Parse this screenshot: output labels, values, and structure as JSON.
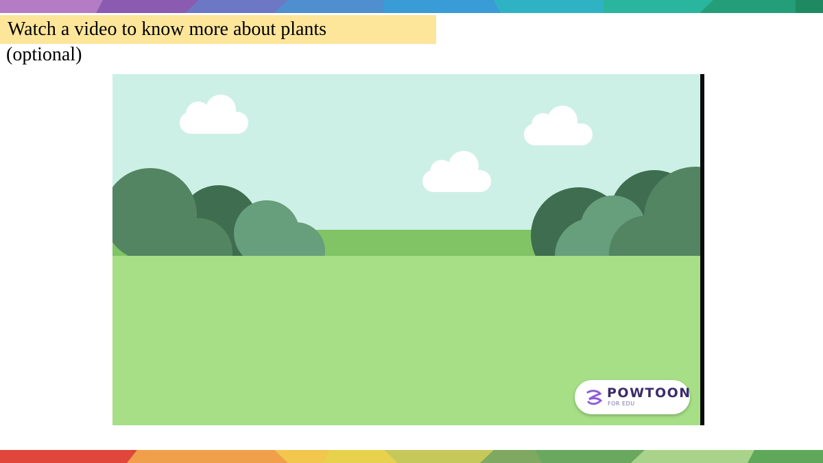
{
  "slide": {
    "title": "Watch a video to know more about plants",
    "subtitle": "(optional)"
  },
  "video": {
    "badge_name": "POWTOON",
    "badge_sub": "FOR EDU"
  },
  "colors": {
    "title_highlight": "#fde59a",
    "sky": "#cdf0e6",
    "grass": "#a6df86",
    "far_grass": "#80c466",
    "bush_dark": "#3f6d4f",
    "bush_mid": "#548562",
    "bush_light": "#679e7c",
    "badge_text": "#3b2c6b",
    "badge_accent": "#8e5bd6"
  }
}
